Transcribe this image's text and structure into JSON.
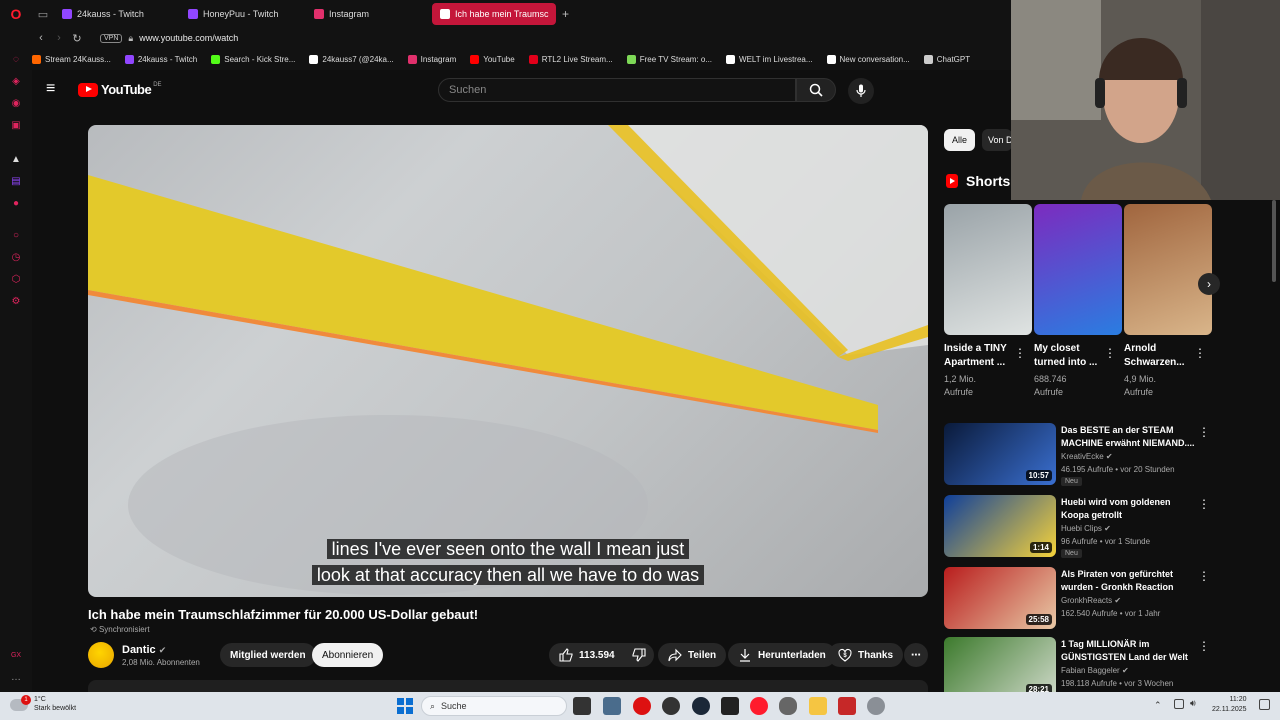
{
  "browser": {
    "tabs": [
      {
        "label": "24kauss - Twitch",
        "color": "#9146ff"
      },
      {
        "label": "HoneyPuu - Twitch",
        "color": "#9146ff"
      },
      {
        "label": "Instagram",
        "color": "#e1306c"
      },
      {
        "label": "Ich habe mein Traumsc",
        "color": "#ff0000",
        "active": true
      }
    ],
    "vpn_label": "VPN",
    "url": "www.youtube.com/watch",
    "bookmarks": [
      {
        "label": "Stream 24Kauss...",
        "color": "#ff6600"
      },
      {
        "label": "24kauss - Twitch",
        "color": "#9146ff"
      },
      {
        "label": "Search - Kick Stre...",
        "color": "#53fc18"
      },
      {
        "label": "24kauss7 (@24ka...",
        "color": "#ffffff"
      },
      {
        "label": "Instagram",
        "color": "#e1306c"
      },
      {
        "label": "YouTube",
        "color": "#ff0000"
      },
      {
        "label": "RTL2 Live Stream...",
        "color": "#e2001a"
      },
      {
        "label": "Free TV Stream: o...",
        "color": "#7ed957"
      },
      {
        "label": "WELT im Livestrea...",
        "color": "#ffffff"
      },
      {
        "label": "New conversation...",
        "color": "#ffffff"
      },
      {
        "label": "ChatGPT",
        "color": "#cccccc"
      }
    ]
  },
  "youtube": {
    "logo_text": "YouTube",
    "country_code": "DE",
    "search_placeholder": "Suchen",
    "video": {
      "subtitle_line1": "lines I've ever seen onto the wall I mean just",
      "subtitle_line2": "look at that accuracy then all we have to do was",
      "title": "Ich habe mein Traumschlafzimmer für 20.000 US-Dollar gebaut!",
      "sync_label": "Synchronisiert",
      "channel": "Dantic",
      "subscribers": "2,08 Mio. Abonnenten",
      "member_label": "Mitglied werden",
      "subscribe_label": "Abonnieren",
      "likes": "113.594",
      "share_label": "Teilen",
      "download_label": "Herunterladen",
      "thanks_label": "Thanks"
    },
    "chips": {
      "all": "Alle",
      "from": "Von Dantic"
    },
    "shorts_heading": "Shorts",
    "shorts": [
      {
        "title": "Inside a TINY Apartment ...",
        "views": "1,2 Mio. Aufrufe",
        "colors": [
          "#9aa3a8",
          "#dfe3e2"
        ]
      },
      {
        "title": "My closet turned into ...",
        "views": "688.746 Aufrufe",
        "colors": [
          "#7c2bbf",
          "#2a7de1"
        ]
      },
      {
        "title": "Arnold Schwarzen...",
        "views": "4,9 Mio. Aufrufe",
        "colors": [
          "#a0653e",
          "#d9b58a"
        ]
      }
    ],
    "recommendations": [
      {
        "title": "Das BESTE an der STEAM MACHINE erwähnt NIEMAND....",
        "channel": "KreativEcke",
        "meta": "46.195 Aufrufe • vor 20 Stunden",
        "new": "Neu",
        "duration": "10:57",
        "colors": [
          "#0a1a3a",
          "#3a6fd0"
        ]
      },
      {
        "title": "Huebi wird vom goldenen Koopa getrollt",
        "channel": "Huebi Clips",
        "meta": "96 Aufrufe • vor 1 Stunde",
        "new": "Neu",
        "duration": "1:14",
        "colors": [
          "#0f3f9a",
          "#f6d33a"
        ]
      },
      {
        "title": "Als Piraten von gefürchtet wurden - Gronkh Reaction",
        "channel": "GronkhReacts",
        "meta": "162.540 Aufrufe • vor 1 Jahr",
        "new": "",
        "duration": "25:58",
        "colors": [
          "#b91d1d",
          "#e8c9a6"
        ]
      },
      {
        "title": "1 Tag MILLIONÄR im GÜNSTIGSTEN Land der Welt",
        "channel": "Fabian Baggeler",
        "meta": "198.118 Aufrufe • vor 3 Wochen",
        "new": "",
        "duration": "28:21",
        "colors": [
          "#3c7a2c",
          "#cfd9c9"
        ]
      }
    ]
  },
  "taskbar": {
    "temperature": "1°C",
    "weather": "Stark bewölkt",
    "notification_count": "1",
    "search_label": "Suche",
    "time": "11:20",
    "date": "22.11.2025"
  }
}
